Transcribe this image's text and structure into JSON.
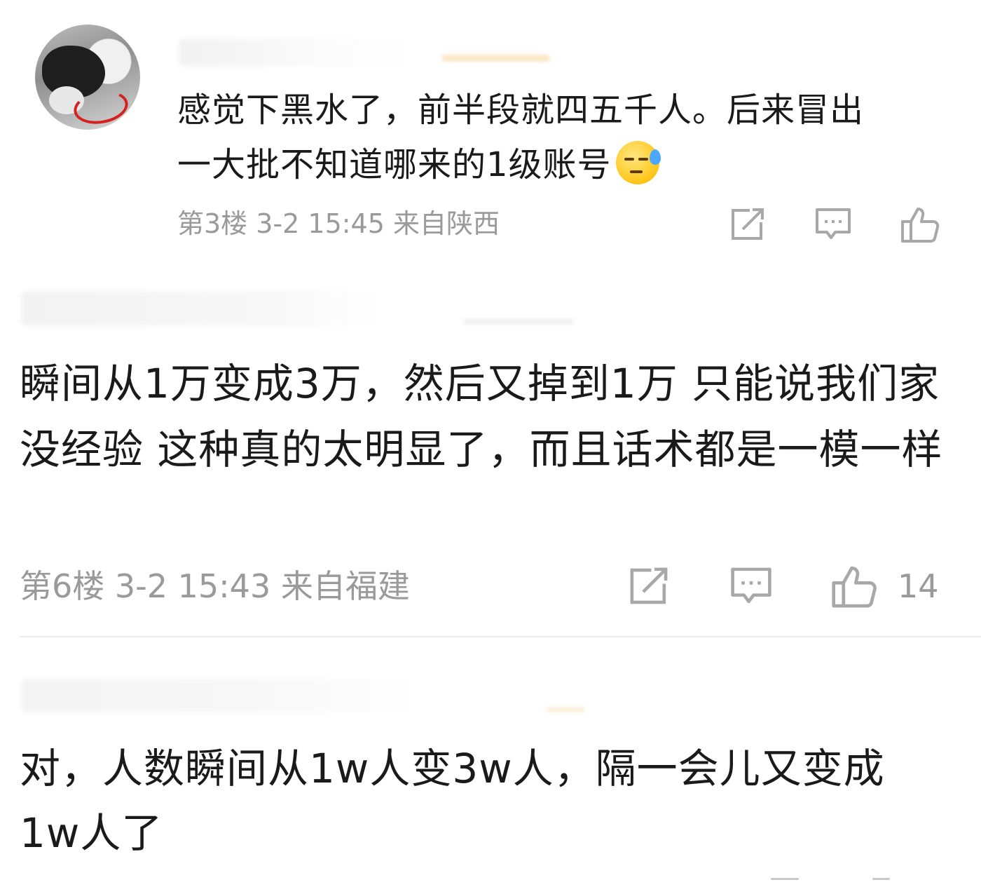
{
  "comments": [
    {
      "text_line1": "感觉下黑水了，前半段就四五千人。后来冒出",
      "text_line2": "一大批不知道哪来的1级账号",
      "emoji": "sweat-face",
      "meta": "第3楼 3-2 15:45 来自陕西"
    },
    {
      "text": "瞬间从1万变成3万，然后又掉到1万 只能说我们家没经验 这种真的太明显了，而且话术都是一模一样",
      "meta": "第6楼 3-2 15:43 来自福建",
      "likes": "14"
    },
    {
      "text": "对，人数瞬间从1w人变3w人，隔一会儿又变成1w人了"
    }
  ],
  "colors": {
    "text": "#1a1a1a",
    "meta": "#9a9a9a",
    "icon": "#a8a8a8",
    "divider": "#ececec"
  },
  "icons": [
    "share-edit-icon",
    "comment-icon",
    "like-icon"
  ]
}
